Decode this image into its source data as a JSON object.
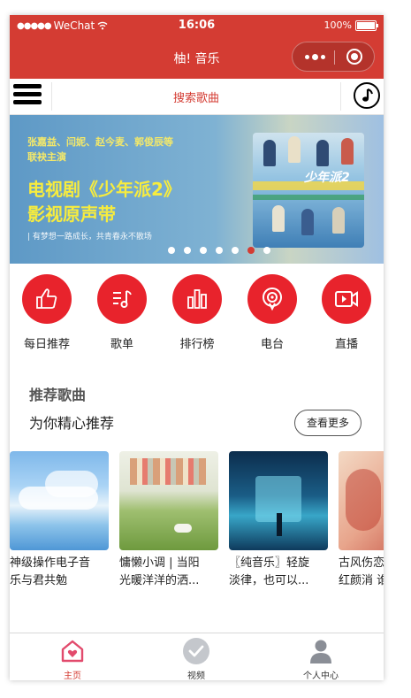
{
  "status_bar": {
    "carrier": "WeChat",
    "time": "16:06",
    "battery": "100%"
  },
  "nav": {
    "title": "柚! 音乐"
  },
  "search": {
    "text": "搜索歌曲"
  },
  "banner": {
    "cast_line1": "张嘉益、闫妮、赵今麦、郭俊辰等",
    "cast_line2": "联袂主演",
    "headline_line1": "电视剧《少年派2》",
    "headline_line2": "影视原声带",
    "slogan": "| 有梦想一路成长，共青春永不散场",
    "poster_title": "少年派2",
    "page_count": 7,
    "active_page": 5
  },
  "icon_nav": [
    {
      "label": "每日推荐",
      "icon": "thumbs-up-icon"
    },
    {
      "label": "歌单",
      "icon": "playlist-icon"
    },
    {
      "label": "排行榜",
      "icon": "ranking-icon"
    },
    {
      "label": "电台",
      "icon": "radio-icon"
    },
    {
      "label": "直播",
      "icon": "video-live-icon"
    }
  ],
  "recommend": {
    "title": "推荐歌曲",
    "subtitle": "为你精心推荐",
    "more_label": "查看更多",
    "cards": [
      {
        "line1": "神级操作电子音",
        "line2": "乐与君共勉"
      },
      {
        "line1": "慵懒小调 | 当阳",
        "line2": "光暖洋洋的洒..."
      },
      {
        "line1": "〖纯音乐〗轻旋",
        "line2": "淡律，也可以..."
      },
      {
        "line1": "古风伤恋",
        "line2": "红颜消 谁"
      }
    ]
  },
  "tabbar": [
    {
      "label": "主页",
      "icon": "home-icon",
      "active": true
    },
    {
      "label": "视频",
      "icon": "check-circle-icon",
      "active": false
    },
    {
      "label": "个人中心",
      "icon": "user-icon",
      "active": false
    }
  ],
  "colors": {
    "primary": "#d43c33",
    "icon_circle": "#e8232c"
  }
}
